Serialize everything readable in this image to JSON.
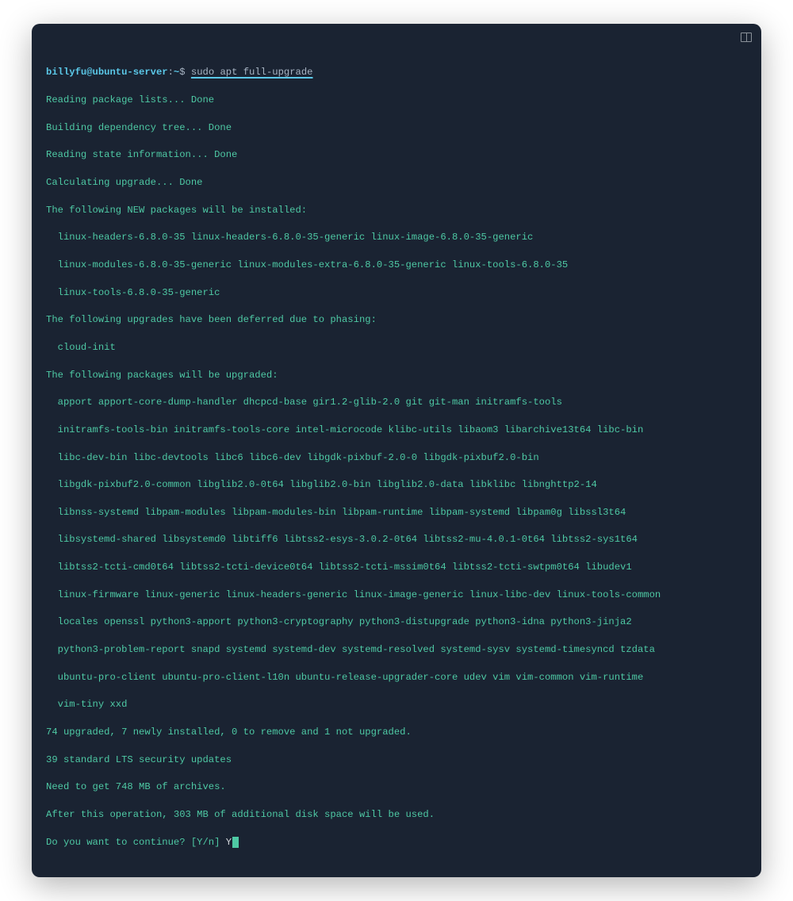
{
  "prompt": {
    "user_host": "billyfu@ubuntu-server",
    "separator": ":",
    "path": "~",
    "symbol": "$",
    "command": "sudo apt full-upgrade"
  },
  "output": {
    "reading_packages": "Reading package lists... Done",
    "building_tree": "Building dependency tree... Done",
    "reading_state": "Reading state information... Done",
    "calculating": "Calculating upgrade... Done",
    "new_header": "The following NEW packages will be installed:",
    "new_line1": "linux-headers-6.8.0-35 linux-headers-6.8.0-35-generic linux-image-6.8.0-35-generic",
    "new_line2": "linux-modules-6.8.0-35-generic linux-modules-extra-6.8.0-35-generic linux-tools-6.8.0-35",
    "new_line3": "linux-tools-6.8.0-35-generic",
    "deferred_header": "The following upgrades have been deferred due to phasing:",
    "deferred_line1": "cloud-init",
    "upgraded_header": "The following packages will be upgraded:",
    "upg_line1": "apport apport-core-dump-handler dhcpcd-base gir1.2-glib-2.0 git git-man initramfs-tools",
    "upg_line2": "initramfs-tools-bin initramfs-tools-core intel-microcode klibc-utils libaom3 libarchive13t64 libc-bin",
    "upg_line3": "libc-dev-bin libc-devtools libc6 libc6-dev libgdk-pixbuf-2.0-0 libgdk-pixbuf2.0-bin",
    "upg_line4": "libgdk-pixbuf2.0-common libglib2.0-0t64 libglib2.0-bin libglib2.0-data libklibc libnghttp2-14",
    "upg_line5": "libnss-systemd libpam-modules libpam-modules-bin libpam-runtime libpam-systemd libpam0g libssl3t64",
    "upg_line6": "libsystemd-shared libsystemd0 libtiff6 libtss2-esys-3.0.2-0t64 libtss2-mu-4.0.1-0t64 libtss2-sys1t64",
    "upg_line7": "libtss2-tcti-cmd0t64 libtss2-tcti-device0t64 libtss2-tcti-mssim0t64 libtss2-tcti-swtpm0t64 libudev1",
    "upg_line8": "linux-firmware linux-generic linux-headers-generic linux-image-generic linux-libc-dev linux-tools-common",
    "upg_line9": "locales openssl python3-apport python3-cryptography python3-distupgrade python3-idna python3-jinja2",
    "upg_line10": "python3-problem-report snapd systemd systemd-dev systemd-resolved systemd-sysv systemd-timesyncd tzdata",
    "upg_line11": "ubuntu-pro-client ubuntu-pro-client-l10n ubuntu-release-upgrader-core udev vim vim-common vim-runtime",
    "upg_line12": "vim-tiny xxd",
    "summary": "74 upgraded, 7 newly installed, 0 to remove and 1 not upgraded.",
    "security": "39 standard LTS security updates",
    "archive_size": "Need to get 748 MB of archives.",
    "disk_space": "After this operation, 303 MB of additional disk space will be used.",
    "confirm_prompt": "Do you want to continue? [Y/n] ",
    "confirm_response": "Y"
  }
}
